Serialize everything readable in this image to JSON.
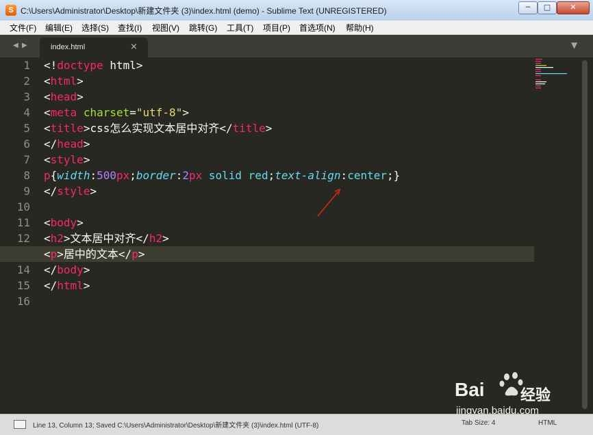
{
  "window": {
    "app_icon": "sublime-icon",
    "title": "C:\\Users\\Administrator\\Desktop\\新建文件夹 (3)\\index.html (demo) - Sublime Text (UNREGISTERED)",
    "minimize_glyph": "─",
    "maximize_glyph": "□",
    "close_glyph": "✕"
  },
  "menu": [
    "文件(F)",
    "编辑(E)",
    "选择(S)",
    "查找(I)",
    "视图(V)",
    "跳转(G)",
    "工具(T)",
    "项目(P)",
    "首选项(N)",
    "帮助(H)"
  ],
  "tabs": {
    "nav_left_glyph": "◀",
    "nav_right_glyph": "▶",
    "active": {
      "label": "index.html",
      "close_glyph": "×"
    },
    "menu_glyph": "▼"
  },
  "editor": {
    "line_numbers": [
      "1",
      "2",
      "3",
      "4",
      "5",
      "6",
      "7",
      "8",
      "9",
      "10",
      "11",
      "12",
      "13",
      "14",
      "15",
      "16"
    ],
    "current_line": 13,
    "lines": [
      [
        {
          "t": "<!",
          "c": "pl"
        },
        {
          "t": "doctype",
          "c": "tg"
        },
        {
          "t": " html>",
          "c": "pl"
        }
      ],
      [
        {
          "t": "<",
          "c": "pl"
        },
        {
          "t": "html",
          "c": "tg"
        },
        {
          "t": ">",
          "c": "pl"
        }
      ],
      [
        {
          "t": "<",
          "c": "pl"
        },
        {
          "t": "head",
          "c": "tg"
        },
        {
          "t": ">",
          "c": "pl"
        }
      ],
      [
        {
          "t": "<",
          "c": "pl"
        },
        {
          "t": "meta",
          "c": "tg"
        },
        {
          "t": " ",
          "c": "pl"
        },
        {
          "t": "charset",
          "c": "at"
        },
        {
          "t": "=",
          "c": "pl"
        },
        {
          "t": "\"utf-8\"",
          "c": "st"
        },
        {
          "t": ">",
          "c": "pl"
        }
      ],
      [
        {
          "t": "<",
          "c": "pl"
        },
        {
          "t": "title",
          "c": "tg"
        },
        {
          "t": ">css怎么实现文本居中对齐</",
          "c": "pl"
        },
        {
          "t": "title",
          "c": "tg"
        },
        {
          "t": ">",
          "c": "pl"
        }
      ],
      [
        {
          "t": "</",
          "c": "pl"
        },
        {
          "t": "head",
          "c": "tg"
        },
        {
          "t": ">",
          "c": "pl"
        }
      ],
      [
        {
          "t": "<",
          "c": "pl"
        },
        {
          "t": "style",
          "c": "tg"
        },
        {
          "t": ">",
          "c": "pl"
        }
      ],
      [
        {
          "t": "p",
          "c": "tg"
        },
        {
          "t": "{",
          "c": "pl"
        },
        {
          "t": "width",
          "c": "pr"
        },
        {
          "t": ":",
          "c": "pl"
        },
        {
          "t": "500",
          "c": "nm"
        },
        {
          "t": "px",
          "c": "tg"
        },
        {
          "t": ";",
          "c": "pl"
        },
        {
          "t": "border",
          "c": "pr"
        },
        {
          "t": ":",
          "c": "pl"
        },
        {
          "t": "2",
          "c": "nm"
        },
        {
          "t": "px",
          "c": "tg"
        },
        {
          "t": " solid red",
          "c": "kw"
        },
        {
          "t": ";",
          "c": "pl"
        },
        {
          "t": "text-align",
          "c": "pr"
        },
        {
          "t": ":",
          "c": "pl"
        },
        {
          "t": "center",
          "c": "kw"
        },
        {
          "t": ";}",
          "c": "pl"
        }
      ],
      [
        {
          "t": "</",
          "c": "pl"
        },
        {
          "t": "style",
          "c": "tg"
        },
        {
          "t": ">",
          "c": "pl"
        }
      ],
      [],
      [
        {
          "t": "<",
          "c": "pl"
        },
        {
          "t": "body",
          "c": "tg"
        },
        {
          "t": ">",
          "c": "pl"
        }
      ],
      [
        {
          "t": "<",
          "c": "pl"
        },
        {
          "t": "h2",
          "c": "tg"
        },
        {
          "t": ">文本居中对齐</",
          "c": "pl"
        },
        {
          "t": "h2",
          "c": "tg"
        },
        {
          "t": ">",
          "c": "pl"
        }
      ],
      [
        {
          "t": "<",
          "c": "pl"
        },
        {
          "t": "p",
          "c": "tg"
        },
        {
          "t": ">居中的文本</",
          "c": "pl"
        },
        {
          "t": "p",
          "c": "tg"
        },
        {
          "t": ">",
          "c": "pl"
        }
      ],
      [
        {
          "t": "</",
          "c": "pl"
        },
        {
          "t": "body",
          "c": "tg"
        },
        {
          "t": ">",
          "c": "pl"
        }
      ],
      [
        {
          "t": "</",
          "c": "pl"
        },
        {
          "t": "html",
          "c": "tg"
        },
        {
          "t": ">",
          "c": "pl"
        }
      ],
      []
    ],
    "annotation": {
      "shape": "red-arrow",
      "points_to": "text-align"
    }
  },
  "statusbar": {
    "icon": "console-icon",
    "text": "Line 13, Column 13; Saved C:\\Users\\Administrator\\Desktop\\新建文件夹 (3)\\index.html (UTF-8)",
    "tab_size": "Tab Size: 4",
    "syntax": "HTML"
  },
  "watermark": {
    "logo": "baidu-paw-logo",
    "brand_latin": "Bai",
    "brand_cn": "经验",
    "url": "jingyan.baidu.com"
  },
  "colors": {
    "background": "#272822",
    "tag": "#f92672",
    "attribute": "#a6e22e",
    "string": "#e6db74",
    "property": "#66d9ef",
    "number": "#ae81ff",
    "plain": "#f8f8f2",
    "arrow": "#d7261d"
  }
}
